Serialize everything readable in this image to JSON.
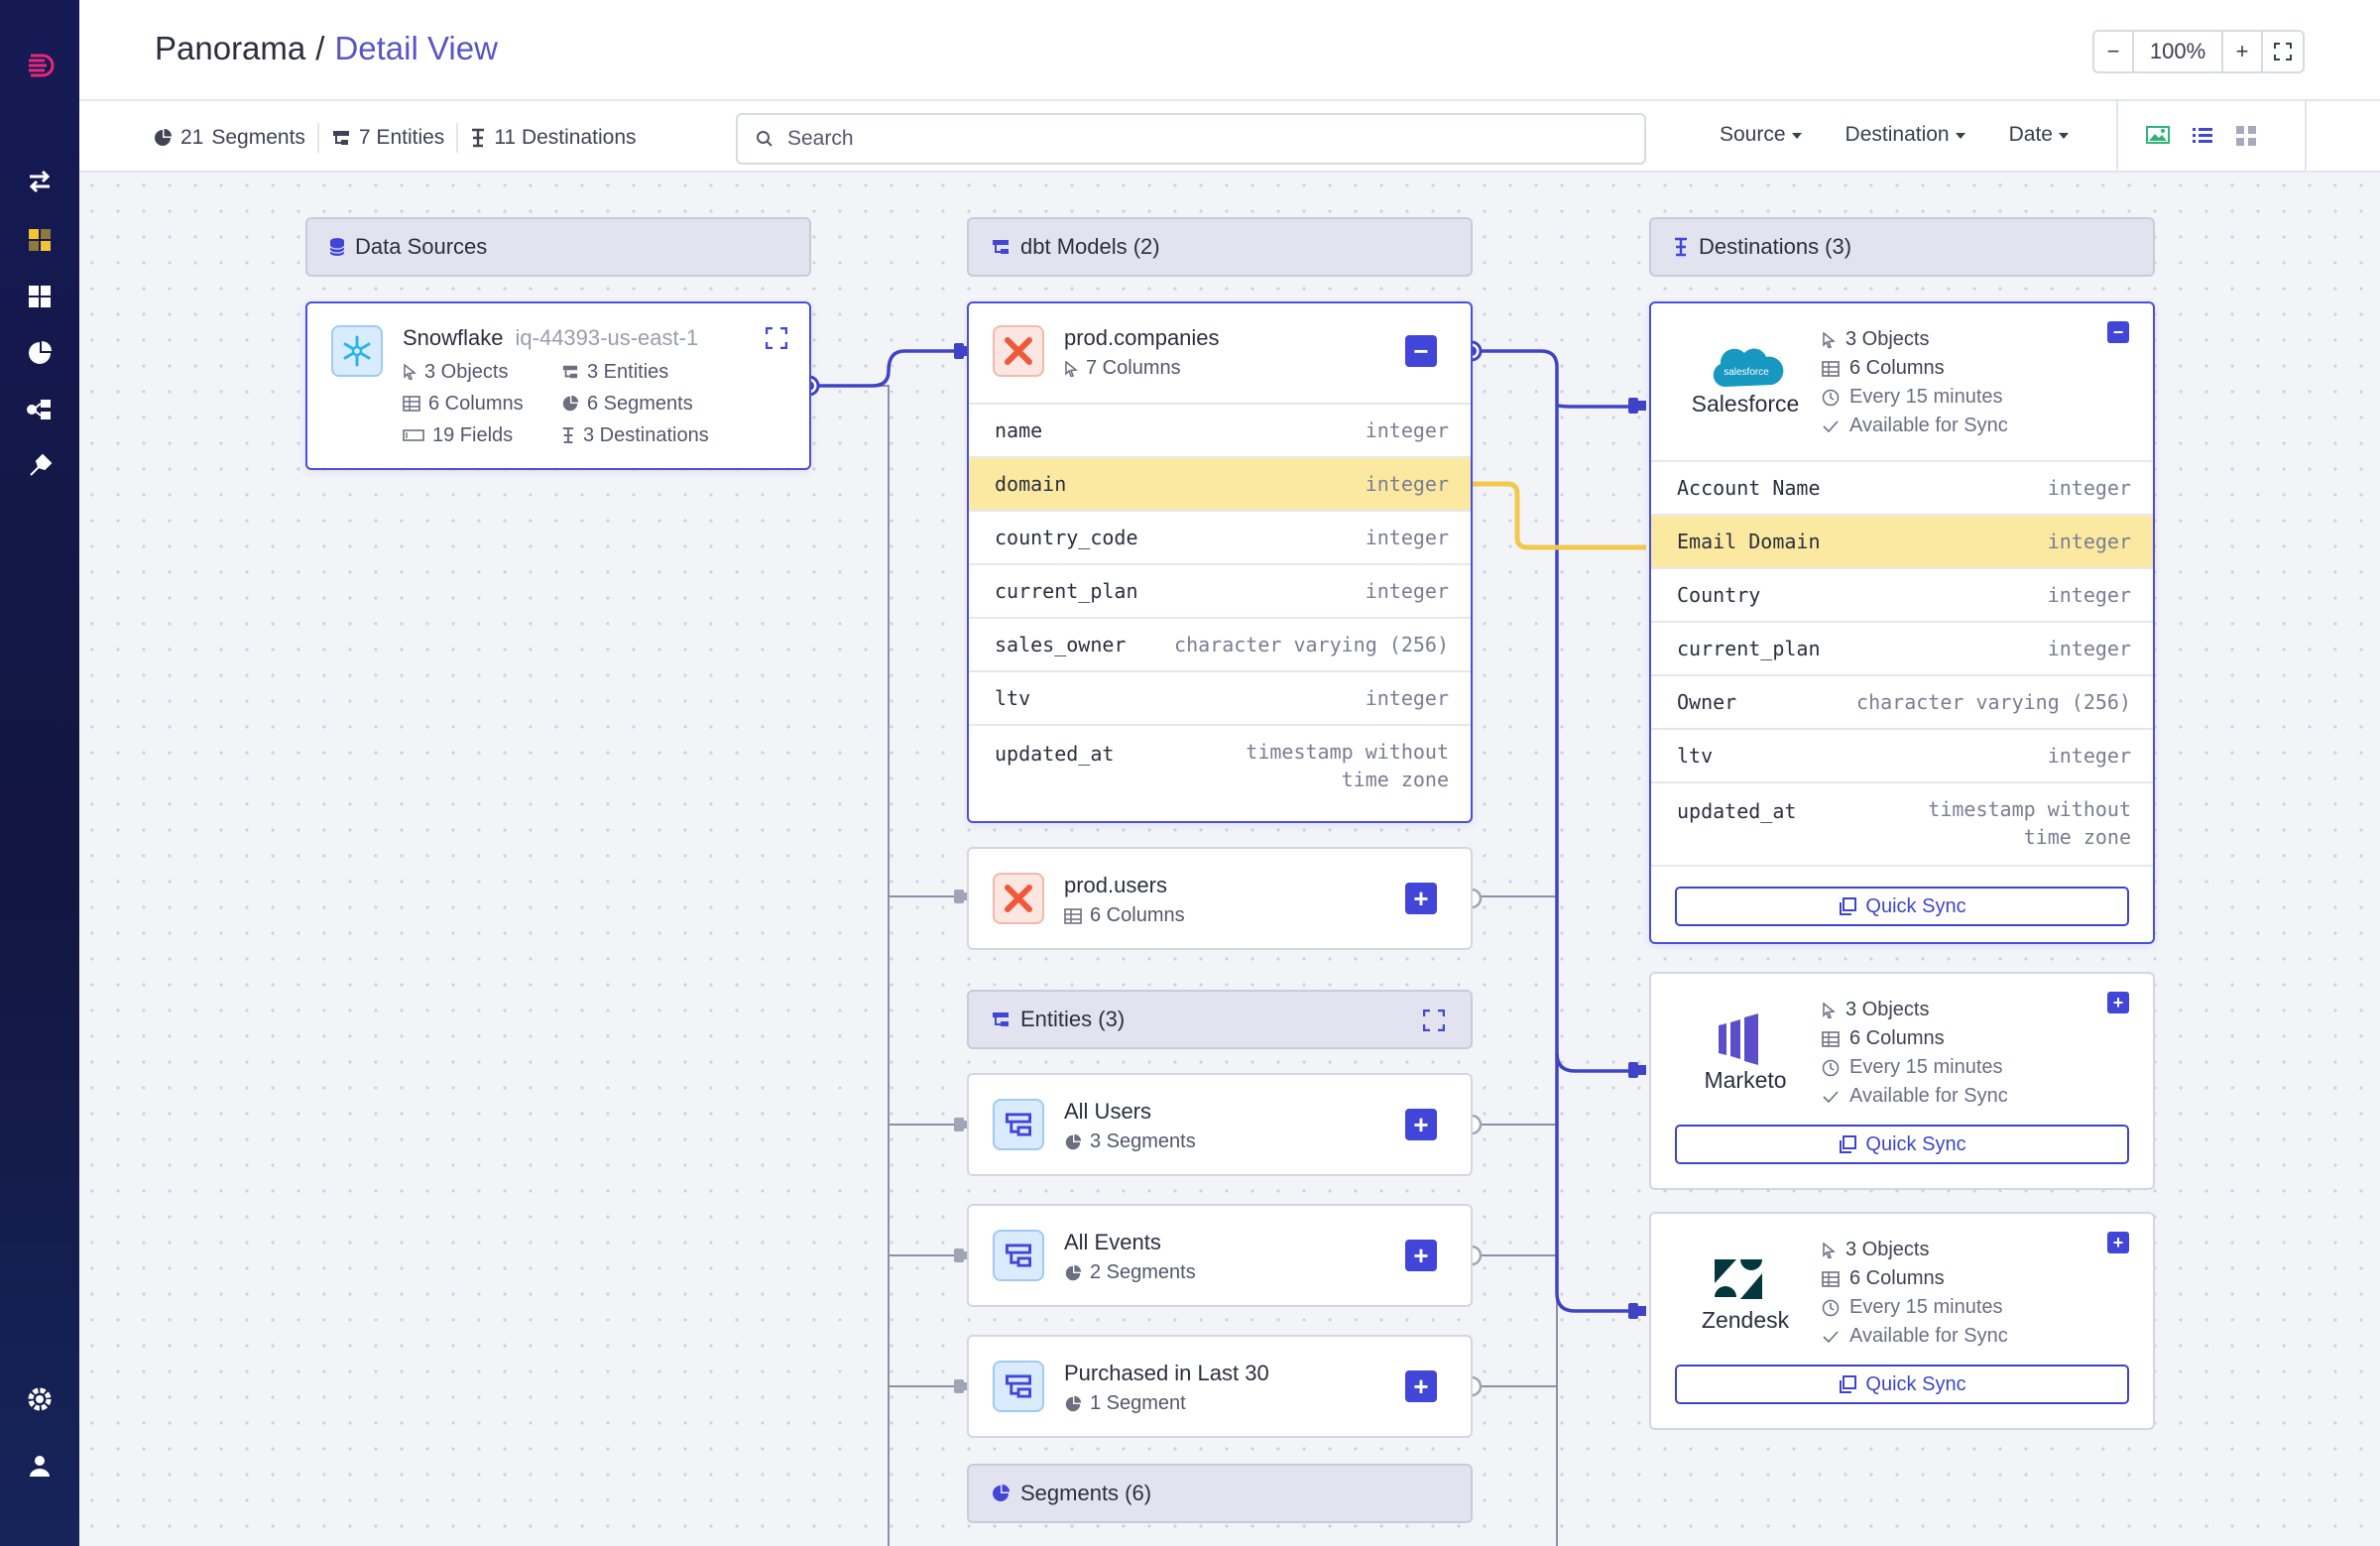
{
  "sidebar": {
    "icons": [
      "brand-logo-icon",
      "sync-arrows-icon",
      "models-icon",
      "dashboard-icon",
      "segments-pie-icon",
      "destinations-icon",
      "extensions-icon",
      "settings-icon",
      "user-icon"
    ]
  },
  "header": {
    "root": "Panorama",
    "separator": "/",
    "current": "Detail View",
    "zoom": {
      "minus": "−",
      "value": "100%",
      "plus": "+"
    }
  },
  "toolbar": {
    "segments": {
      "count": "21",
      "label": "Segments"
    },
    "entities": "7 Entities",
    "destinations": "11 Destinations",
    "search_placeholder": "Search",
    "filters": [
      "Source",
      "Destination",
      "Date"
    ]
  },
  "sections": {
    "data_sources": "Data Sources",
    "dbt_models": "dbt Models (2)",
    "destinations": "Destinations (3)",
    "entities": "Entities (3)",
    "segments": "Segments (6)"
  },
  "source": {
    "name": "Snowflake",
    "id": "iq-44393-us-east-1",
    "objects": "3 Objects",
    "entities": "3 Entities",
    "columns": "6 Columns",
    "segments": "6 Segments",
    "fields": "19 Fields",
    "destinations": "3 Destinations"
  },
  "model_companies": {
    "name": "prod.companies",
    "columns_label": "7 Columns",
    "toggle": "−",
    "rows": [
      {
        "name": "name",
        "type": "integer"
      },
      {
        "name": "domain",
        "type": "integer"
      },
      {
        "name": "country_code",
        "type": "integer"
      },
      {
        "name": "current_plan",
        "type": "integer"
      },
      {
        "name": "sales_owner",
        "type": "character varying (256)"
      },
      {
        "name": "ltv",
        "type": "integer"
      },
      {
        "name": "updated_at",
        "type_line1": "timestamp without",
        "type_line2": "time zone"
      }
    ]
  },
  "model_users": {
    "name": "prod.users",
    "columns_label": "6 Columns",
    "toggle": "+"
  },
  "entities": [
    {
      "name": "All Users",
      "segments": "3 Segments",
      "toggle": "+"
    },
    {
      "name": "All Events",
      "segments": "2 Segments",
      "toggle": "+"
    },
    {
      "name": "Purchased in Last 30",
      "segments": "1 Segment",
      "toggle": "+"
    }
  ],
  "destinations": [
    {
      "name": "Salesforce",
      "logo_text": "salesforce",
      "objects": "3 Objects",
      "columns": "6 Columns",
      "schedule": "Every 15 minutes",
      "status": "Available for Sync",
      "toggle": "−",
      "rows": [
        {
          "name": "Account Name",
          "type": "integer"
        },
        {
          "name": "Email Domain",
          "type": "integer"
        },
        {
          "name": "Country",
          "type": "integer"
        },
        {
          "name": "current_plan",
          "type": "integer"
        },
        {
          "name": "Owner",
          "type": "character varying (256)"
        },
        {
          "name": "ltv",
          "type": "integer"
        },
        {
          "name": "updated_at",
          "type_line1": "timestamp without",
          "type_line2": "time zone"
        }
      ],
      "action": "Quick Sync"
    },
    {
      "name": "Marketo",
      "objects": "3 Objects",
      "columns": "6 Columns",
      "schedule": "Every 15 minutes",
      "status": "Available for Sync",
      "toggle": "+",
      "action": "Quick Sync"
    },
    {
      "name": "Zendesk",
      "objects": "3 Objects",
      "columns": "6 Columns",
      "schedule": "Every 15 minutes",
      "status": "Available for Sync",
      "toggle": "+",
      "action": "Quick Sync"
    }
  ],
  "colors": {
    "accent": "#4146d9",
    "highlight": "#fbe9a1",
    "highlight_wire": "#f2c94c",
    "sidebar": "#151a55"
  }
}
